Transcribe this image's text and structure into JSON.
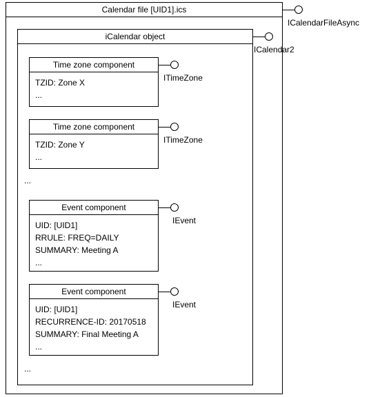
{
  "outer": {
    "title": "Calendar file [UID1].ics",
    "iface": "ICalendarFileAsync"
  },
  "inner": {
    "title": "iCalendar object",
    "iface": "ICalendar2",
    "ellipsis1": "...",
    "ellipsis2": "..."
  },
  "tz1": {
    "title": "Time zone component",
    "iface": "ITimeZone",
    "line1": "TZID: Zone X",
    "line2": "..."
  },
  "tz2": {
    "title": "Time zone component",
    "iface": "ITimeZone",
    "line1": "TZID: Zone Y",
    "line2": "..."
  },
  "ev1": {
    "title": "Event component",
    "iface": "IEvent",
    "line1": "UID: [UID1]",
    "line2": "RRULE: FREQ=DAILY",
    "line3": "SUMMARY: Meeting A",
    "line4": "..."
  },
  "ev2": {
    "title": "Event component",
    "iface": "IEvent",
    "line1": "UID: [UID1]",
    "line2": "RECURRENCE-ID: 20170518",
    "line3": "SUMMARY: Final Meeting A",
    "line4": "..."
  }
}
